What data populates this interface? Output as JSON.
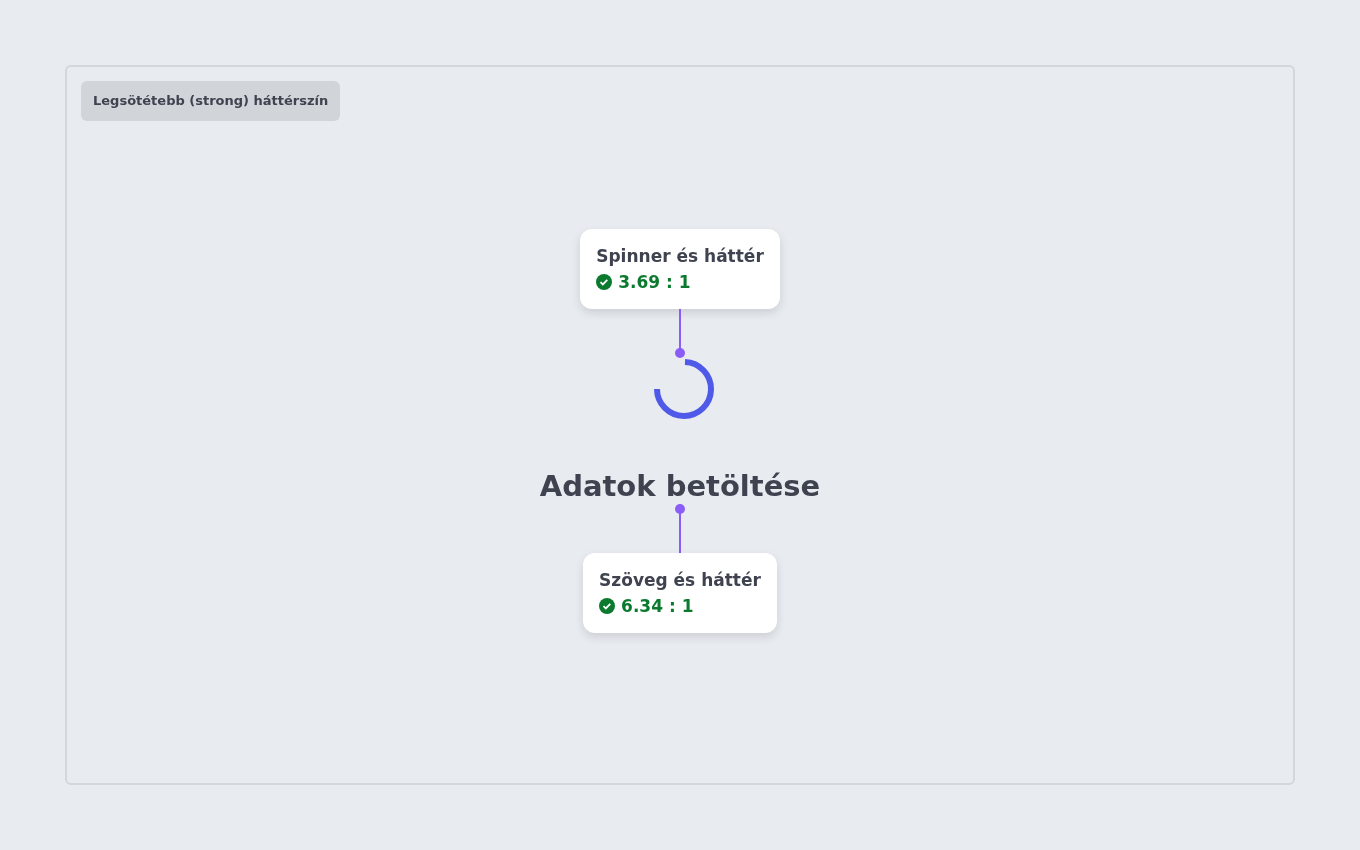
{
  "panel": {
    "label": "Legsötétebb (strong) háttérszín"
  },
  "annotations": [
    {
      "title": "Spinner és háttér",
      "ratio": "3.69 : 1",
      "pass": true
    },
    {
      "title": "Szöveg és háttér",
      "ratio": "6.34 : 1",
      "pass": true
    }
  ],
  "loading": {
    "text": "Adatok betöltése"
  }
}
